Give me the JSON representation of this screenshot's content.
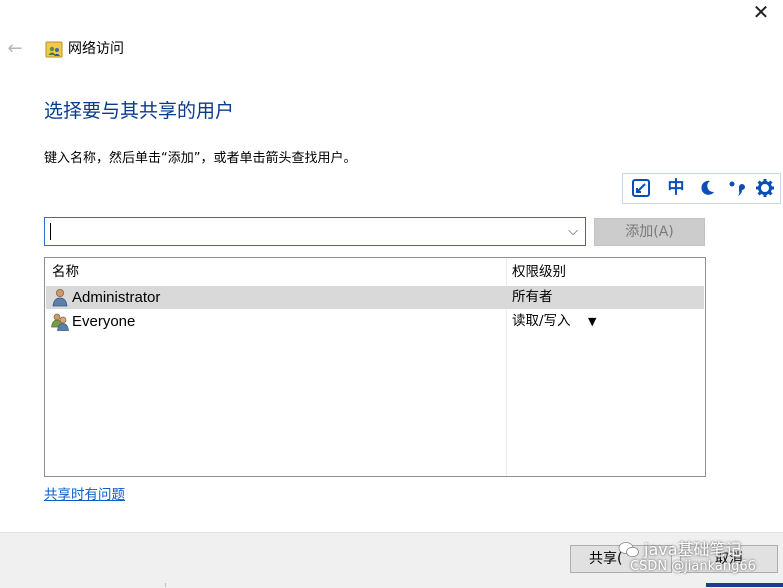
{
  "window": {
    "title": "网络访问",
    "close_glyph": "✕",
    "back_glyph": "←"
  },
  "heading": "选择要与其共享的用户",
  "instruction": "键入名称，然后单击“添加”，或者单击箭头查找用户。",
  "ime_toolbar": {
    "items": [
      "",
      "中",
      "",
      "",
      ""
    ]
  },
  "name_combo": {
    "value": "",
    "placeholder": "",
    "arrow_glyph": "⌵"
  },
  "add_button": {
    "label": "添加(A)"
  },
  "user_list": {
    "columns": [
      "名称",
      "权限级别"
    ],
    "rows": [
      {
        "name": "Administrator",
        "permission": "所有者",
        "icon": "user-icon",
        "selected": true
      },
      {
        "name": "Everyone",
        "permission": "读取/写入",
        "icon": "group-icon",
        "selected": false,
        "has_dropdown": true
      }
    ]
  },
  "help_link": "共享时有问题",
  "footer": {
    "share_label": "共享(",
    "cancel_label": "取消"
  },
  "watermark": {
    "line1": "java基础笔记",
    "line2": "CSDN @jiankang66"
  },
  "colors": {
    "heading": "#0a3a8c",
    "link": "#0a5fc8",
    "selection": "#d9d9d9",
    "focus_border": "#2a6fca",
    "ime_accent": "#0a4fb9"
  }
}
